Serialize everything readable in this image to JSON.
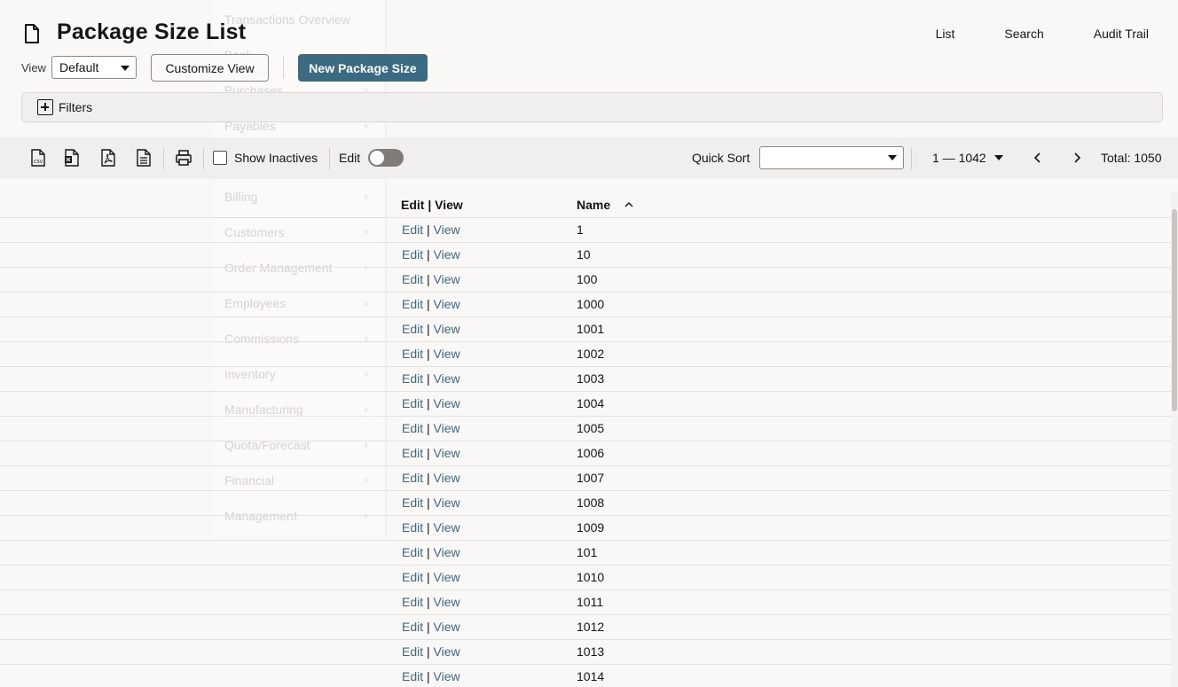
{
  "ghost_menu": [
    {
      "label": "Transactions Overview",
      "chevron": false
    },
    {
      "label": "Bank",
      "chevron": true
    },
    {
      "label": "Purchases",
      "chevron": true
    },
    {
      "label": "Payables",
      "chevron": true
    },
    {
      "label": "",
      "chevron": false
    },
    {
      "label": "Billing",
      "chevron": true
    },
    {
      "label": "Customers",
      "chevron": true
    },
    {
      "label": "Order Management",
      "chevron": true
    },
    {
      "label": "Employees",
      "chevron": true
    },
    {
      "label": "Commissions",
      "chevron": true
    },
    {
      "label": "Inventory",
      "chevron": true
    },
    {
      "label": "Manufacturing",
      "chevron": true
    },
    {
      "label": "Quota/Forecast",
      "chevron": true
    },
    {
      "label": "Financial",
      "chevron": true
    },
    {
      "label": "Management",
      "chevron": true
    }
  ],
  "header": {
    "title": "Package Size List",
    "nav": [
      "List",
      "Search",
      "Audit Trail"
    ]
  },
  "controls": {
    "view_label": "View",
    "view_value": "Default",
    "customize_label": "Customize View",
    "new_label": "New Package Size",
    "filters_label": "Filters"
  },
  "toolbar": {
    "icons": [
      "export-csv-icon",
      "export-excel-icon",
      "export-pdf-icon",
      "export-document-icon",
      "print-icon"
    ],
    "show_inactives_label": "Show Inactives",
    "show_inactives_checked": false,
    "edit_label": "Edit",
    "edit_toggle_on": false,
    "quick_sort_label": "Quick Sort",
    "quick_sort_value": "",
    "range_label": "1 — 1042",
    "total_label": "Total: 1050"
  },
  "table": {
    "columns": [
      "Edit | View",
      "Name"
    ],
    "sort_column": "Name",
    "sort_direction": "ascending",
    "edit_link": "Edit",
    "view_link": "View",
    "rows": [
      "1",
      "10",
      "100",
      "1000",
      "1001",
      "1002",
      "1003",
      "1004",
      "1005",
      "1006",
      "1007",
      "1008",
      "1009",
      "101",
      "1010",
      "1011",
      "1012",
      "1013",
      "1014"
    ]
  },
  "colors": {
    "accent": "#3b6b82",
    "link": "#3b6b82",
    "toolbar_bg": "#f1efed",
    "page_bg": "#f9f8f7"
  }
}
